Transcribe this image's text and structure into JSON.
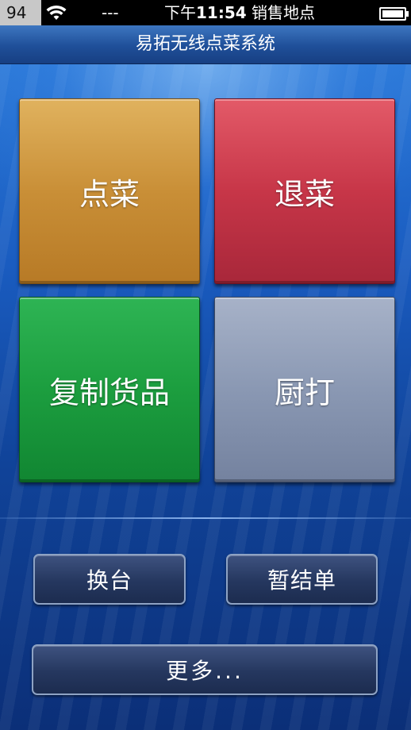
{
  "status_bar": {
    "signal": "94",
    "carrier": "---",
    "time_prefix": "下午",
    "time": "11:54",
    "location": "销售地点"
  },
  "title_bar": {
    "title": "易拓无线点菜系统"
  },
  "tiles": {
    "order": {
      "label": "点菜",
      "color": "#c98f37"
    },
    "return": {
      "label": "退菜",
      "color": "#c73648"
    },
    "copy": {
      "label": "复制货品",
      "color": "#1c9e3f"
    },
    "kitchen": {
      "label": "厨打",
      "color": "#8a98b3"
    }
  },
  "buttons": {
    "switch_table": "换台",
    "temp_settle": "暂结单",
    "more": "更多..."
  },
  "colors": {
    "background": "#1a5cc0",
    "title_bar": "#1f4f99"
  }
}
